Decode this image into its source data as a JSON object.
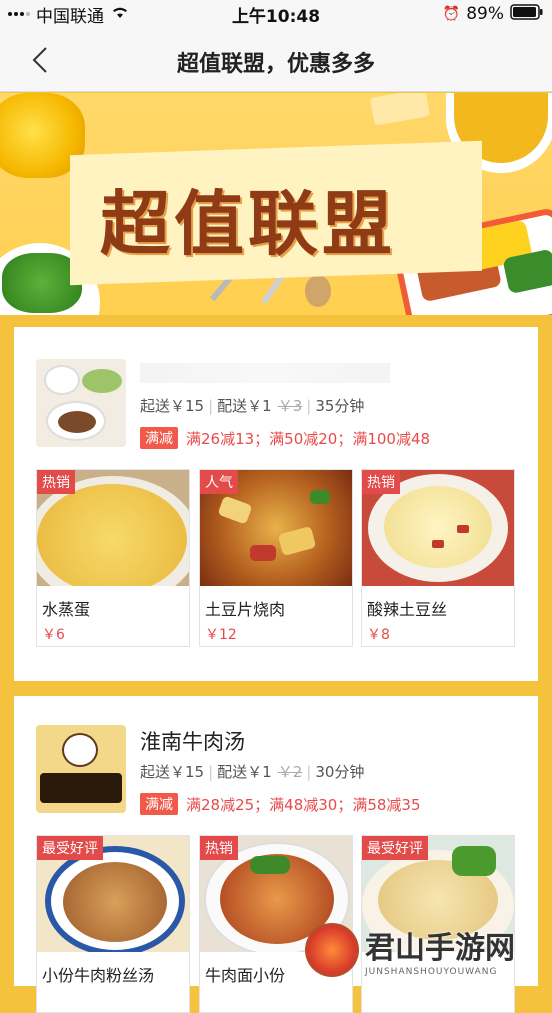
{
  "status": {
    "carrier": "中国联通",
    "time": "上午10:48",
    "battery": "89%"
  },
  "nav": {
    "title": "超值联盟，优惠多多"
  },
  "banner": {
    "title": "超值联盟"
  },
  "stores": [
    {
      "name": "",
      "min_order": "起送￥15",
      "delivery": "配送￥1",
      "old_delivery": "￥3",
      "time": "35分钟",
      "promo_tag": "满减",
      "promo_text": "满26减13；满50减20；满100减48",
      "dishes": [
        {
          "badge": "热销",
          "name": "水蒸蛋",
          "price": "￥6"
        },
        {
          "badge": "人气",
          "name": "土豆片烧肉",
          "price": "￥12"
        },
        {
          "badge": "热销",
          "name": "酸辣土豆丝",
          "price": "￥8"
        }
      ]
    },
    {
      "name": "淮南牛肉汤",
      "min_order": "起送￥15",
      "delivery": "配送￥1",
      "old_delivery": "￥2",
      "time": "30分钟",
      "promo_tag": "满减",
      "promo_text": "满28减25；满48减30；满58减35",
      "dishes": [
        {
          "badge": "最受好评",
          "name": "小份牛肉粉丝汤",
          "price": ""
        },
        {
          "badge": "热销",
          "name": "牛肉面小份",
          "price": ""
        },
        {
          "badge": "最受好评",
          "name": "",
          "price": ""
        }
      ]
    }
  ],
  "watermark": {
    "text": "君山手游网",
    "sub": "JUNSHANSHOUYOUWANG"
  }
}
